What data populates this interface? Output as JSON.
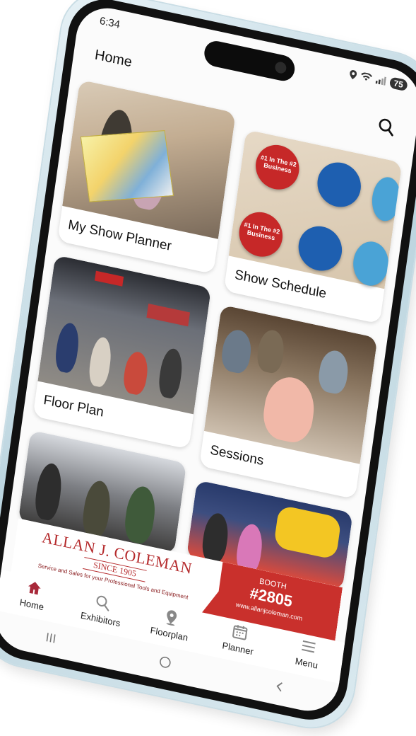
{
  "status": {
    "time": "6:34",
    "battery": "75",
    "icons": [
      "location-icon",
      "wifi-icon",
      "signal-icon"
    ]
  },
  "header": {
    "title": "Home",
    "search_icon": "search-icon"
  },
  "tiles": [
    {
      "label": "My Show Planner"
    },
    {
      "label": "Show Schedule"
    },
    {
      "label": "Floor Plan"
    },
    {
      "label": "Sessions"
    }
  ],
  "schedule_pin_text": "#1 In The #2 Business",
  "ad": {
    "company": "ALLAN J. COLEMAN",
    "since": "SINCE 1905",
    "tagline": "Service and Sales for your Professional Tools and Equipment",
    "booth_label": "BOOTH",
    "booth_number": "#2805",
    "url": "www.allanjcoleman.com"
  },
  "bottom_nav": [
    {
      "label": "Home",
      "icon": "home-icon",
      "active": true
    },
    {
      "label": "Exhibitors",
      "icon": "search-icon"
    },
    {
      "label": "Floorplan",
      "icon": "map-pin-icon"
    },
    {
      "label": "Planner",
      "icon": "calendar-icon"
    },
    {
      "label": "Menu",
      "icon": "hamburger-icon"
    }
  ],
  "colors": {
    "accent": "#a8293a",
    "ad_red": "#c9302c",
    "pin_red": "#c62828",
    "pin_blue": "#1e5fb0",
    "pin_light_blue": "#4aa3d6"
  }
}
